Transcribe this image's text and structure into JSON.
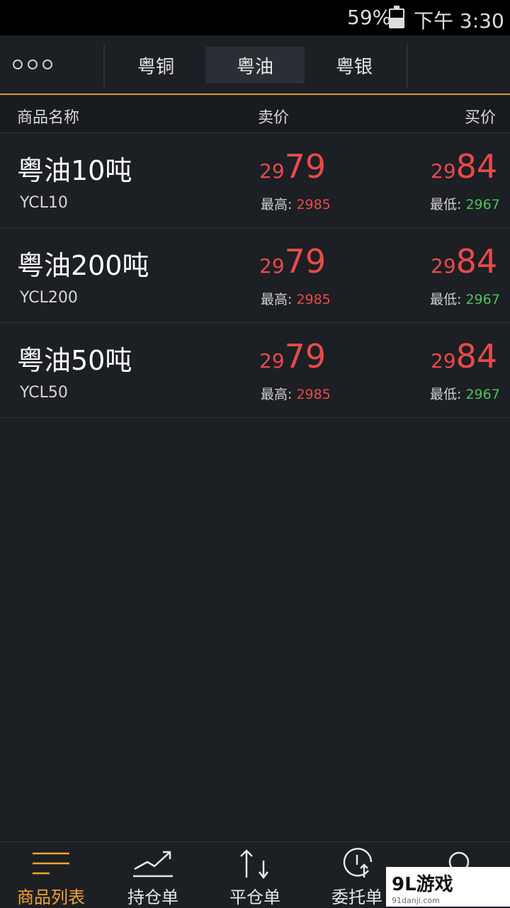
{
  "status_bar": {
    "battery": "59%",
    "time": "下午 3:30"
  },
  "top_nav": {
    "tabs": [
      {
        "label": "粤铜",
        "active": false
      },
      {
        "label": "粤油",
        "active": true
      },
      {
        "label": "粤银",
        "active": false
      }
    ]
  },
  "columns": {
    "name": "商品名称",
    "sell": "卖价",
    "buy": "买价"
  },
  "rows": [
    {
      "name": "粤油10吨",
      "code": "YCL10",
      "sell_prefix": "29",
      "sell_main": "79",
      "buy_prefix": "29",
      "buy_main": "84",
      "high_label": "最高: ",
      "high": "2985",
      "low_label": "最低: ",
      "low": "2967"
    },
    {
      "name": "粤油200吨",
      "code": "YCL200",
      "sell_prefix": "29",
      "sell_main": "79",
      "buy_prefix": "29",
      "buy_main": "84",
      "high_label": "最高: ",
      "high": "2985",
      "low_label": "最低: ",
      "low": "2967"
    },
    {
      "name": "粤油50吨",
      "code": "YCL50",
      "sell_prefix": "29",
      "sell_main": "79",
      "buy_prefix": "29",
      "buy_main": "84",
      "high_label": "最高: ",
      "high": "2985",
      "low_label": "最低: ",
      "low": "2967"
    }
  ],
  "bottom_nav": {
    "items": [
      {
        "label": "商品列表",
        "icon": "list-icon",
        "active": true
      },
      {
        "label": "持仓单",
        "icon": "trend-chart-icon",
        "active": false
      },
      {
        "label": "平仓单",
        "icon": "up-down-arrows-icon",
        "active": false
      },
      {
        "label": "委托单",
        "icon": "clock-upload-icon",
        "active": false
      },
      {
        "label": "",
        "icon": "user-icon",
        "active": false
      }
    ]
  },
  "watermark": {
    "brand": "9L游戏",
    "url": "91danji.com"
  },
  "colors": {
    "price_red": "#e84a4a",
    "low_green": "#4fc25a",
    "accent": "#f2a430"
  }
}
